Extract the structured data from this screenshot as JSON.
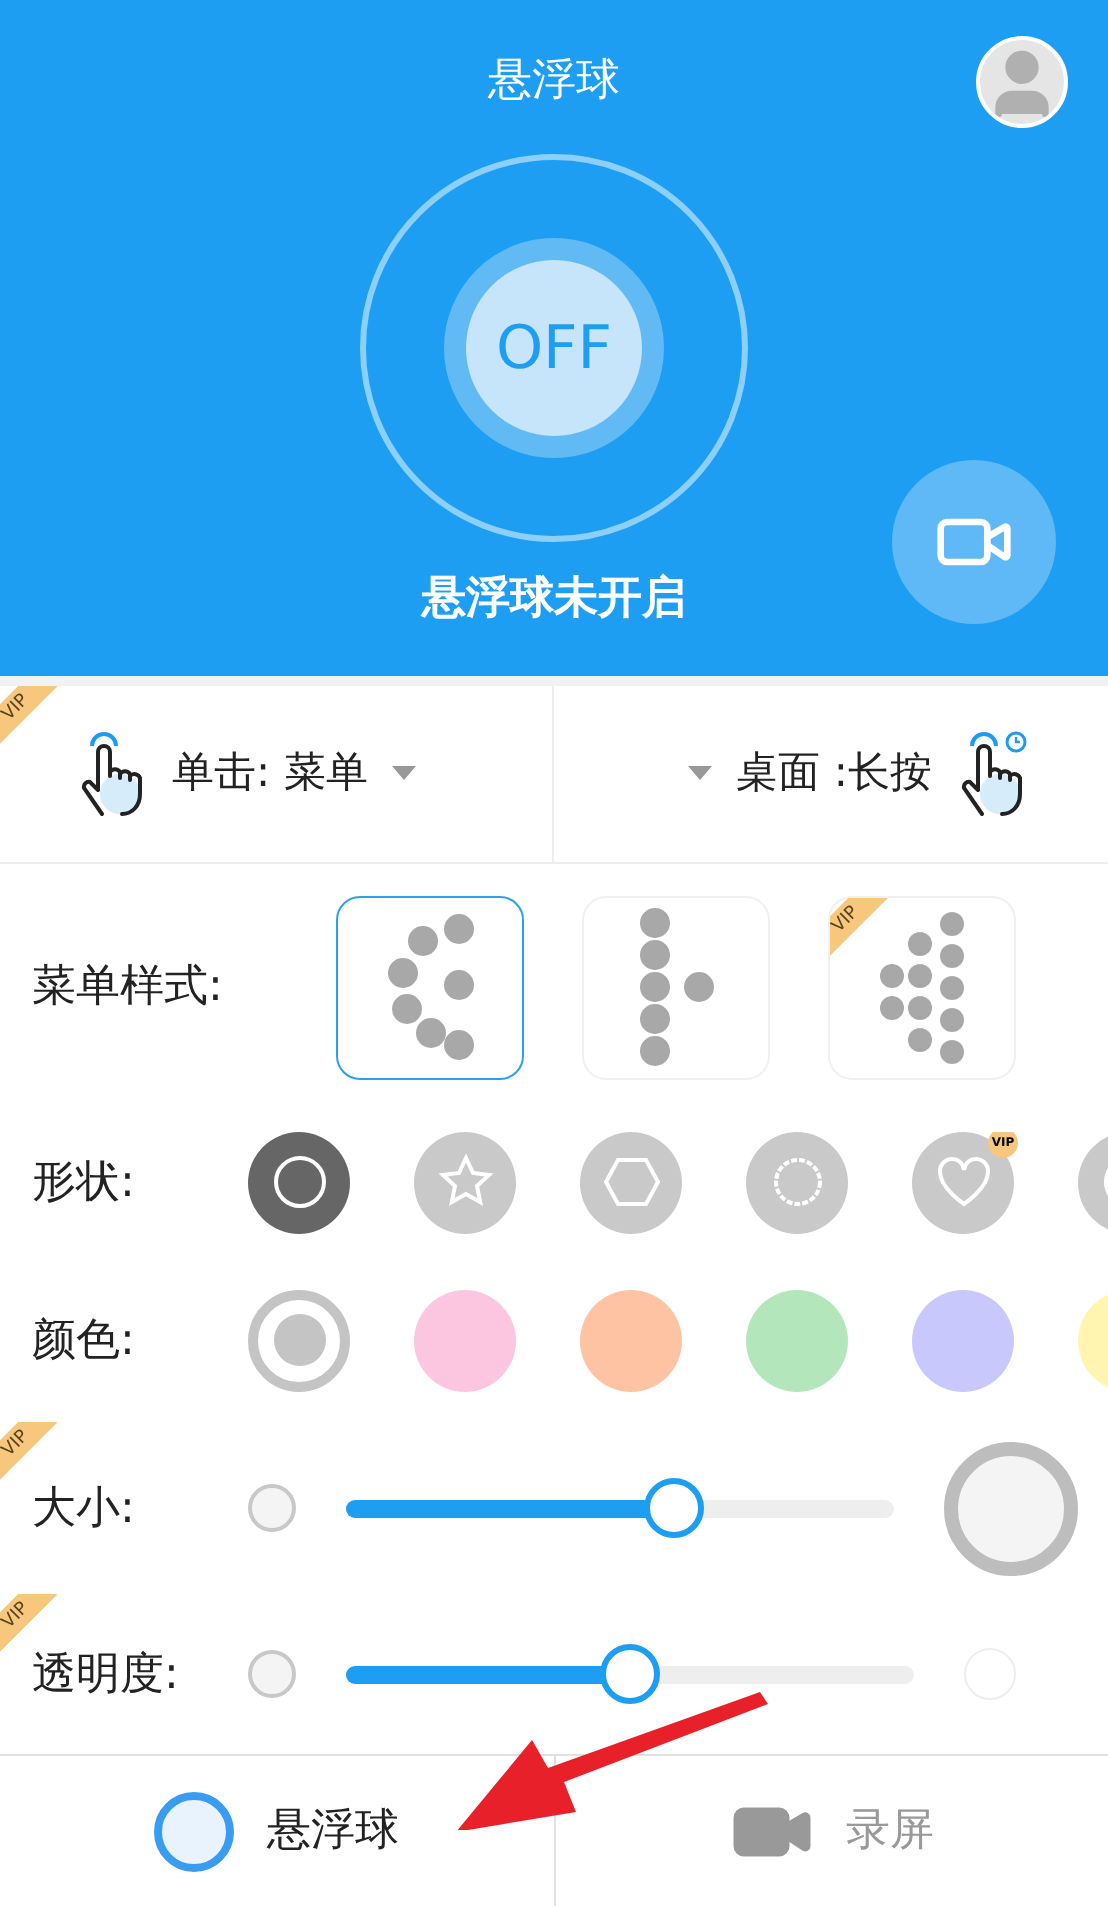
{
  "header": {
    "title": "悬浮球",
    "toggle_label": "OFF",
    "toggle_on": false,
    "status": "悬浮球未开启"
  },
  "gestures": {
    "badge": "VIP",
    "items": [
      {
        "text": "单击: 菜单",
        "timed": false
      },
      {
        "text": "桌面 :长按",
        "timed": true
      }
    ]
  },
  "menu_style": {
    "label": "菜单样式:",
    "options": [
      {
        "kind": "arc",
        "selected": true
      },
      {
        "kind": "column",
        "selected": false
      },
      {
        "kind": "grid",
        "selected": false,
        "badge": "VIP"
      }
    ]
  },
  "shape": {
    "label": "形状:",
    "options": [
      {
        "kind": "circle",
        "selected": true
      },
      {
        "kind": "star",
        "selected": false
      },
      {
        "kind": "hexagon",
        "selected": false
      },
      {
        "kind": "flower",
        "selected": false
      },
      {
        "kind": "heart",
        "selected": false,
        "badge": "VIP"
      },
      {
        "kind": "circle",
        "selected": false
      }
    ]
  },
  "color": {
    "label": "颜色:",
    "options": [
      {
        "color": "#c4c4c4",
        "selected": true
      },
      {
        "color": "#fcc6e0",
        "selected": false
      },
      {
        "color": "#fdc3a3",
        "selected": false
      },
      {
        "color": "#b3e6bb",
        "selected": false
      },
      {
        "color": "#c8c8fc",
        "selected": false
      },
      {
        "color": "#fff5b0",
        "selected": false
      }
    ]
  },
  "sliders": [
    {
      "label": "大小:",
      "badge": "VIP",
      "level": 0.6,
      "kind": "size"
    },
    {
      "label": "透明度:",
      "badge": "VIP",
      "level": 0.5,
      "kind": "opacity"
    }
  ],
  "bottom_nav": [
    {
      "label": "悬浮球",
      "kind": "ball",
      "selected": true
    },
    {
      "label": "录屏",
      "kind": "record",
      "selected": false
    }
  ]
}
